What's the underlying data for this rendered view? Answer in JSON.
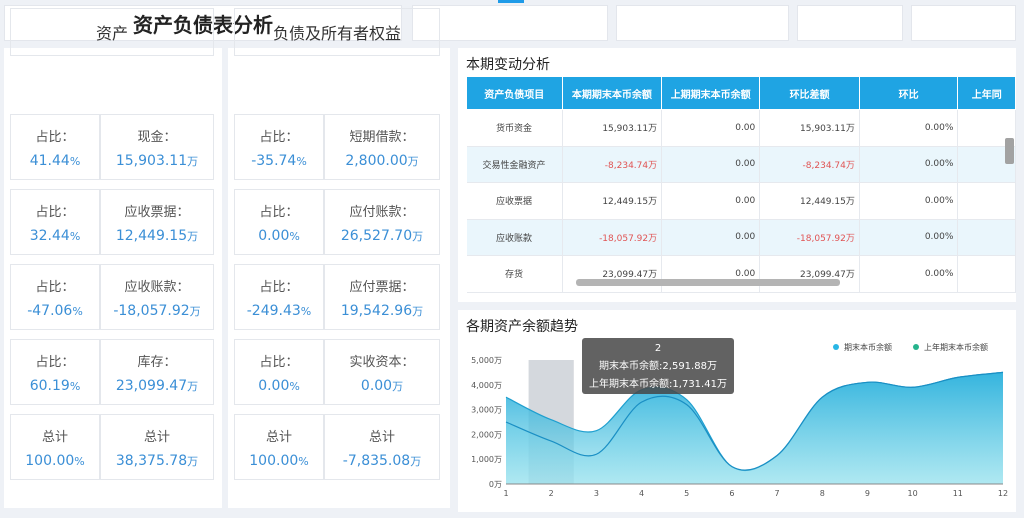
{
  "header": {
    "title": "资产负债表分析"
  },
  "assets": {
    "heading": "资产",
    "rows": [
      {
        "left_label": "占比：",
        "left_value": "41.44",
        "left_unit": "%",
        "right_label": "现金：",
        "right_value": "15,903.11",
        "right_unit": "万"
      },
      {
        "left_label": "占比：",
        "left_value": "32.44",
        "left_unit": "%",
        "right_label": "应收票据：",
        "right_value": "12,449.15",
        "right_unit": "万"
      },
      {
        "left_label": "占比：",
        "left_value": "-47.06",
        "left_unit": "%",
        "right_label": "应收账款：",
        "right_value": "-18,057.92",
        "right_unit": "万"
      },
      {
        "left_label": "占比：",
        "left_value": "60.19",
        "left_unit": "%",
        "right_label": "库存：",
        "right_value": "23,099.47",
        "right_unit": "万"
      },
      {
        "left_label": "总计",
        "left_value": "100.00",
        "left_unit": "%",
        "right_label": "总计",
        "right_value": "38,375.78",
        "right_unit": "万"
      }
    ]
  },
  "liabilities": {
    "heading": "负债及所有者权益",
    "rows": [
      {
        "left_label": "占比：",
        "left_value": "-35.74",
        "left_unit": "%",
        "right_label": "短期借款：",
        "right_value": "2,800.00",
        "right_unit": "万"
      },
      {
        "left_label": "占比：",
        "left_value": "0.00",
        "left_unit": "%",
        "right_label": "应付账款：",
        "right_value": "26,527.70",
        "right_unit": "万"
      },
      {
        "left_label": "占比：",
        "left_value": "-249.43",
        "left_unit": "%",
        "right_label": "应付票据：",
        "right_value": "19,542.96",
        "right_unit": "万"
      },
      {
        "left_label": "占比：",
        "left_value": "0.00",
        "left_unit": "%",
        "right_label": "实收资本：",
        "right_value": "0.00",
        "right_unit": "万"
      },
      {
        "left_label": "总计",
        "left_value": "100.00",
        "left_unit": "%",
        "right_label": "总计",
        "right_value": "-7,835.08",
        "right_unit": "万"
      }
    ]
  },
  "change_table": {
    "title": "本期变动分析",
    "columns": [
      "资产负债项目",
      "本期期末本币余额",
      "上期期末本币余额",
      "环比差额",
      "环比",
      "上年同"
    ],
    "rows": [
      [
        "货币资金",
        "15,903.11万",
        "0.00",
        "15,903.11万",
        "0.00%"
      ],
      [
        "交易性金融资产",
        "-8,234.74万",
        "0.00",
        "-8,234.74万",
        "0.00%"
      ],
      [
        "应收票据",
        "12,449.15万",
        "0.00",
        "12,449.15万",
        "0.00%"
      ],
      [
        "应收账款",
        "-18,057.92万",
        "0.00",
        "-18,057.92万",
        "0.00%"
      ],
      [
        "存货",
        "23,099.47万",
        "0.00",
        "23,099.47万",
        "0.00%"
      ]
    ]
  },
  "trend_chart": {
    "title": "各期资产余额趋势",
    "tooltip": {
      "period": "2",
      "line1": "期末本币余额:2,591.88万",
      "line2": "上年期末本币余额:1,731.41万"
    }
  },
  "colors": {
    "accent": "#1fa4e3",
    "value_blue": "#3b8fd6",
    "negative": "#e05454",
    "series_current": "#29b6e5",
    "series_last_year": "#26b38c"
  },
  "chart_data": {
    "type": "area",
    "title": "各期资产余额趋势",
    "x": [
      1,
      2,
      3,
      4,
      5,
      6,
      7,
      8,
      9,
      10,
      11,
      12
    ],
    "series": [
      {
        "name": "期末本币余额",
        "values": [
          3500,
          2591.88,
          2150,
          3800,
          3400,
          700,
          1150,
          3500,
          4100,
          3900,
          4300,
          4500
        ]
      },
      {
        "name": "上年期末本币余额",
        "values": [
          2500,
          1731.41,
          1200,
          3300,
          3200,
          700,
          1150,
          3500,
          4100,
          3900,
          4300,
          4500
        ]
      }
    ],
    "yticks": [
      "0万",
      "1,000万",
      "2,000万",
      "3,000万",
      "4,000万",
      "5,000万"
    ],
    "ylim": [
      0,
      5000
    ],
    "xlim": [
      1,
      12
    ],
    "highlight_x": 2,
    "legend_position": "top-right",
    "grid": false
  }
}
